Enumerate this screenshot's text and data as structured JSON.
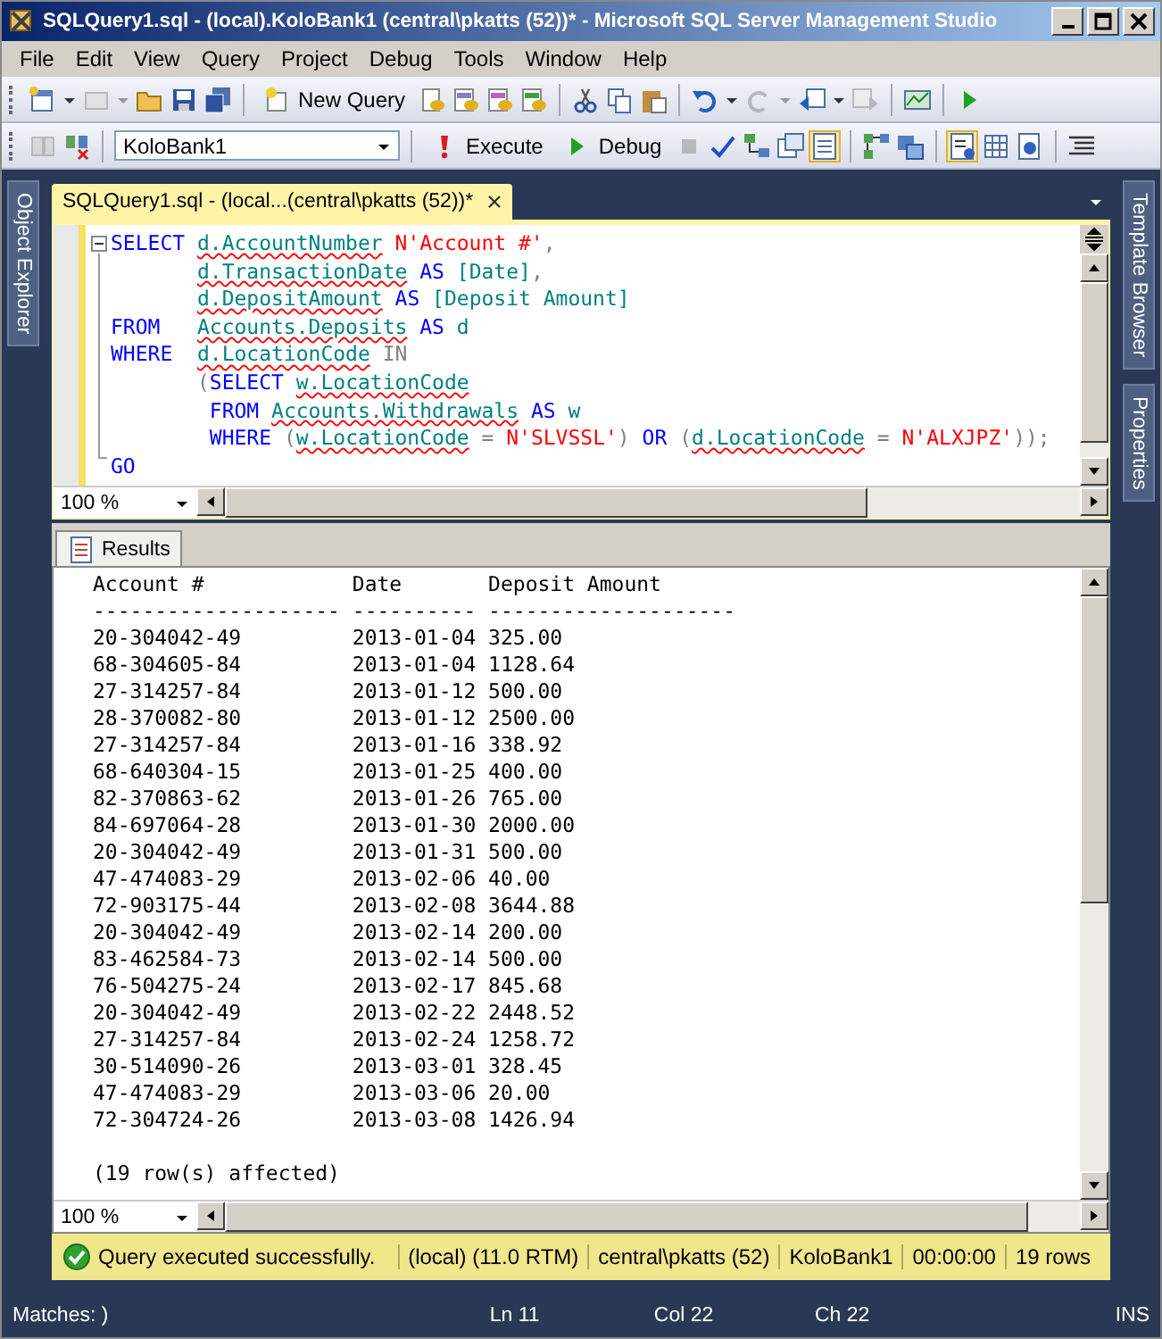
{
  "window": {
    "title": "SQLQuery1.sql - (local).KoloBank1 (central\\pkatts (52))* - Microsoft SQL Server Management Studio"
  },
  "menu": [
    "File",
    "Edit",
    "View",
    "Query",
    "Project",
    "Debug",
    "Tools",
    "Window",
    "Help"
  ],
  "toolbar": {
    "new_query": "New Query",
    "database": "KoloBank1",
    "execute": "Execute",
    "debug": "Debug"
  },
  "side_tabs_left": [
    "Object Explorer"
  ],
  "side_tabs_right": [
    "Template Browser",
    "Properties"
  ],
  "document_tab": {
    "title": "SQLQuery1.sql - (local...(central\\pkatts (52))*"
  },
  "editor": {
    "zoom": "100 %",
    "lines": [
      [
        {
          "kind": "kw",
          "text": "SELECT "
        },
        {
          "kind": "id",
          "text": "d.AccountNumber",
          "error": true
        },
        {
          "kind": "str",
          "text": " N'Account #'"
        },
        {
          "kind": "op",
          "text": ","
        }
      ],
      [
        {
          "kind": "id",
          "text": "       d.TransactionDate",
          "error": true
        },
        {
          "kind": "kw",
          "text": " AS "
        },
        {
          "kind": "id",
          "text": "[Date]"
        },
        {
          "kind": "op",
          "text": ","
        }
      ],
      [
        {
          "kind": "id",
          "text": "       d.DepositAmount",
          "error": true
        },
        {
          "kind": "kw",
          "text": " AS "
        },
        {
          "kind": "id",
          "text": "[Deposit Amount]"
        }
      ],
      [
        {
          "kind": "kw",
          "text": "FROM   "
        },
        {
          "kind": "id",
          "text": "Accounts.Deposits",
          "error": true
        },
        {
          "kind": "kw",
          "text": " AS "
        },
        {
          "kind": "id",
          "text": "d"
        }
      ],
      [
        {
          "kind": "kw",
          "text": "WHERE  "
        },
        {
          "kind": "id",
          "text": "d.LocationCode",
          "error": true
        },
        {
          "kind": "op",
          "text": " IN"
        }
      ],
      [
        {
          "kind": "op",
          "text": "       ("
        },
        {
          "kind": "kw",
          "text": "SELECT "
        },
        {
          "kind": "id",
          "text": "w.LocationCode",
          "error": true
        }
      ],
      [
        {
          "kind": "kw",
          "text": "        FROM "
        },
        {
          "kind": "id",
          "text": "Accounts.Withdrawals",
          "error": true
        },
        {
          "kind": "kw",
          "text": " AS "
        },
        {
          "kind": "id",
          "text": "w"
        }
      ],
      [
        {
          "kind": "kw",
          "text": "        WHERE "
        },
        {
          "kind": "op",
          "text": "("
        },
        {
          "kind": "id",
          "text": "w.LocationCode",
          "error": true
        },
        {
          "kind": "op",
          "text": " = "
        },
        {
          "kind": "str",
          "text": "N'SLVSSL'"
        },
        {
          "kind": "op",
          "text": ")"
        },
        {
          "kind": "kw",
          "text": " OR "
        },
        {
          "kind": "op",
          "text": "("
        },
        {
          "kind": "id",
          "text": "d.LocationCode",
          "error": true
        },
        {
          "kind": "op",
          "text": " = "
        },
        {
          "kind": "str",
          "text": "N'ALXJPZ'"
        },
        {
          "kind": "op",
          "text": "));"
        }
      ],
      [
        {
          "kind": "kw",
          "text": "GO"
        }
      ]
    ]
  },
  "results": {
    "tab": "Results",
    "zoom": "100 %",
    "columns": [
      "Account #",
      "Date",
      "Deposit Amount"
    ],
    "separator": [
      "--------------------",
      "----------",
      "--------------------"
    ],
    "rows": [
      [
        "20-304042-49",
        "2013-01-04",
        "325.00"
      ],
      [
        "68-304605-84",
        "2013-01-04",
        "1128.64"
      ],
      [
        "27-314257-84",
        "2013-01-12",
        "500.00"
      ],
      [
        "28-370082-80",
        "2013-01-12",
        "2500.00"
      ],
      [
        "27-314257-84",
        "2013-01-16",
        "338.92"
      ],
      [
        "68-640304-15",
        "2013-01-25",
        "400.00"
      ],
      [
        "82-370863-62",
        "2013-01-26",
        "765.00"
      ],
      [
        "84-697064-28",
        "2013-01-30",
        "2000.00"
      ],
      [
        "20-304042-49",
        "2013-01-31",
        "500.00"
      ],
      [
        "47-474083-29",
        "2013-02-06",
        "40.00"
      ],
      [
        "72-903175-44",
        "2013-02-08",
        "3644.88"
      ],
      [
        "20-304042-49",
        "2013-02-14",
        "200.00"
      ],
      [
        "83-462584-73",
        "2013-02-14",
        "500.00"
      ],
      [
        "76-504275-24",
        "2013-02-17",
        "845.68"
      ],
      [
        "20-304042-49",
        "2013-02-22",
        "2448.52"
      ],
      [
        "27-314257-84",
        "2013-02-24",
        "1258.72"
      ],
      [
        "30-514090-26",
        "2013-03-01",
        "328.45"
      ],
      [
        "47-474083-29",
        "2013-03-06",
        "20.00"
      ],
      [
        "72-304724-26",
        "2013-03-08",
        "1426.94"
      ]
    ],
    "footer": "(19 row(s) affected)"
  },
  "query_status": {
    "message": "Query executed successfully.",
    "items": [
      "(local) (11.0 RTM)",
      "central\\pkatts (52)",
      "KoloBank1",
      "00:00:00",
      "19 rows"
    ]
  },
  "status_bar": {
    "matches": "Matches: )",
    "ln": "Ln 11",
    "col": "Col 22",
    "ch": "Ch 22",
    "mode": "INS"
  }
}
